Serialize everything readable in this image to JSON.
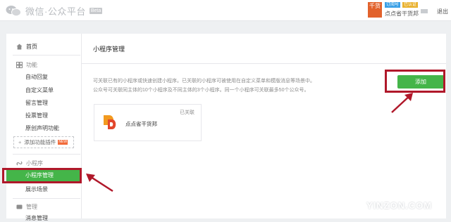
{
  "header": {
    "app_title": "微信·公众平台",
    "beta_label": "Beta",
    "avatar_text": "千货",
    "badge_service": "订阅号",
    "badge_verified": "已认证",
    "account_name": "点点省干货邦",
    "logout_label": "退出"
  },
  "sidebar": {
    "home": "首页",
    "function_section": "功能",
    "function_items": [
      "自动回复",
      "自定义菜单",
      "留言管理",
      "投票管理",
      "原创声明功能"
    ],
    "add_plugin": "添加功能插件",
    "add_plugin_badge": "NEW",
    "miniapp_section": "小程序",
    "miniapp_items": [
      "小程序管理",
      "展示场景"
    ],
    "manage_section": "管理",
    "manage_items": [
      "消息管理"
    ]
  },
  "main": {
    "title": "小程序管理",
    "desc_line1": "可关联已有的小程序或快速创建小程序。已关联的小程序可被使用在自定义菜单和模版消息等场景中。",
    "desc_line2": "公众号可关联同主体的10个小程序及不同主体的3个小程序。同一个小程序可关联最多50个公众号。",
    "add_button": "添加",
    "card": {
      "status": "已关联",
      "name": "点点省干货邦"
    }
  },
  "watermark": "YINZON.COM",
  "colors": {
    "accent_green": "#44b549",
    "highlight_red": "#b0182a",
    "avatar_orange": "#e2622c"
  }
}
